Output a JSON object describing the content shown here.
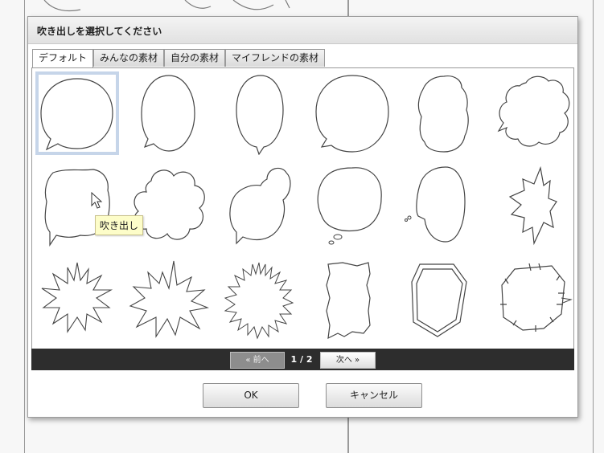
{
  "dialog": {
    "title": "吹き出しを選択してください"
  },
  "tabs": [
    {
      "label": "デフォルト",
      "active": true
    },
    {
      "label": "みんなの素材",
      "active": false
    },
    {
      "label": "自分の素材",
      "active": false
    },
    {
      "label": "マイフレンドの素材",
      "active": false
    }
  ],
  "grid": {
    "items": [
      {
        "icon": "round-balloon-icon",
        "selected": true
      },
      {
        "icon": "oval-balloon-icon"
      },
      {
        "icon": "tall-oval-balloon-icon"
      },
      {
        "icon": "wide-round-balloon-icon"
      },
      {
        "icon": "wavy-balloon-icon"
      },
      {
        "icon": "cloud-balloon-icon"
      },
      {
        "icon": "rough-balloon-icon"
      },
      {
        "icon": "cloud-big-balloon-icon"
      },
      {
        "icon": "double-cloud-balloon-icon"
      },
      {
        "icon": "thought-balloon-icon"
      },
      {
        "icon": "small-tail-balloon-icon"
      },
      {
        "icon": "spiky-balloon-icon"
      },
      {
        "icon": "burst-balloon-icon"
      },
      {
        "icon": "explosion-balloon-icon"
      },
      {
        "icon": "spike-fringe-balloon-icon"
      },
      {
        "icon": "torn-paper-balloon-icon"
      },
      {
        "icon": "double-hexagon-balloon-icon"
      },
      {
        "icon": "stitched-hexagon-balloon-icon"
      }
    ],
    "tooltip": "吹き出し"
  },
  "pager": {
    "prev": "« 前へ",
    "next": "次へ »",
    "page_info": "1 / 2"
  },
  "buttons": {
    "ok": "OK",
    "cancel": "キャンセル"
  }
}
